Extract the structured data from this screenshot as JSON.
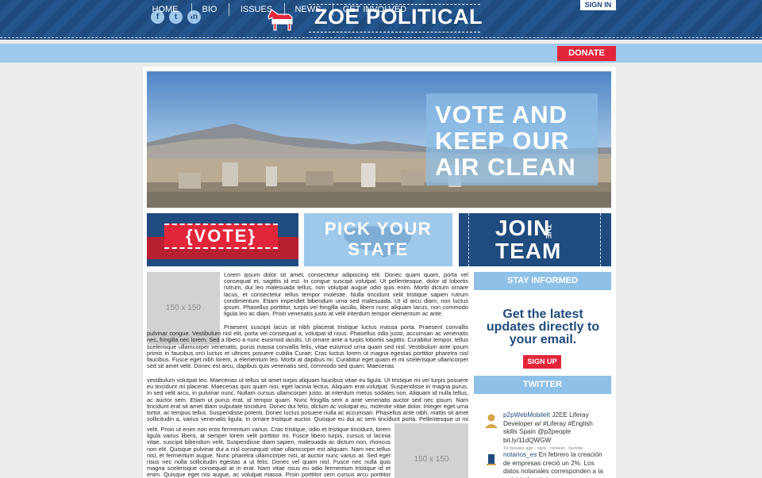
{
  "header": {
    "social": [
      {
        "name": "facebook",
        "glyph": "f"
      },
      {
        "name": "twitter",
        "glyph": "t"
      },
      {
        "name": "linkedin",
        "glyph": "in"
      }
    ],
    "logo_text": "ZOE POLITICAL",
    "signin_label": "SIGN IN"
  },
  "nav": {
    "items": [
      "HOME",
      "BIO",
      "ISSUES",
      "NEWS",
      "GET INVOLVED"
    ],
    "donate_label": "DONATE"
  },
  "hero": {
    "headline_lines": [
      "VOTE AND",
      "KEEP OUR",
      "AIR CLEAN"
    ]
  },
  "tiles": {
    "vote": "{VOTE}",
    "pick_state_lines": [
      "PICK YOUR",
      "STATE"
    ],
    "join": "JOIN",
    "the": "THE",
    "team": "TEAM"
  },
  "placeholders": {
    "label": "150 x 150"
  },
  "article": {
    "p1": "Lorem ipsum dolor sit amet, consectetur adipiscing elit. Donec quam quam, porta vel consequat et, sagittis id est. In congue suscipit volutpat. Ut pellentesque, dolor id lobortis rutrum, dui leo malesuada tellus, non volutpat augue odio quis enim. Morbi dictum ornare lacus, et consectetur tellus tempor molestie. Nulla tincidunt velit tristique sapien rutrum condimentum. Etiam imperdiet bibendum urna sed malesuada. Ut id arcu diam, non luctus ipsum. Phasellus porttitor, turpis vel fringilla iaculis, libero nunc aliquam lacus, non commodo ligula leo ac diam. Proin venenatis justo at velit interdum tempor elementum ac ante.",
    "p2": "Praesent suscipit lacus at nibh placerat tristique luctus massa porta. Praesent convallis pulvinar congue. Vestibulum nisl elit, porta vel consequat a, volutpat id risus. Phasellus odio justo, accumsan ac venenatis nec, fringilla nec lorem. Sed a libero a nunc euismod iaculis. Ut ornare ante a turpis lobortis sagittis. Curabitur tempor, tellus scelerisque ullamcorper venenatis, purus massa convallis felis, vitae euismod urna quam sed nisl. Vestibulum ante ipsum primis in faucibus orci luctus et ultrices posuere cubilia Curae; Cras luctus lorem ut magna egestas porttitor pharetra nisl faucibus. Fusce eget nibh lorem, a elementum leo. Morbi at dapibus mi. Curabitur eget quam et mi scelerisque ullamcorper sed sit amet velit. Donec est arcu, dapibus quis venenatis sed, commodo sed quam. Maecenas",
    "p3": "vestibulum volutpat leo. Maecenas ut tellus sit amet turpis aliquam faucibus vitae eu ligula. Ut tristique mi vel turpis posuere eu tincidunt mi placerat. Maecenas quis quam nisi, eget lacinia lectus. Aliquam erat volutpat. Suspendisse in magna purus. In sed velit arcu, in pulvinar nunc. Nullam cursus ullamcorper justo, at interdum metus sodales non. Aliquam id nulla tellus, ac auctor sem. Etiam ut purus erat, id tempor quam. Nunc fringilla sem a ante venenatis auctor sed nec ipsum. Nam tincidunt erat sit amet diam vulputate tincidunt. Donec dui felis, dictum ac volutpat eu, molestie vitae dolor. Integer eget urna tortor, ac tempus tellus. Suspendisse potenti. Donec luctus posuere nulla ac accumsan. Phasellus ante nibh, mattis sit amet sollicitudin a, varius venenatis ligula. In ornare tristique auctor. Quisque eu dui ac sem tincidunt porta. Pellentesque ut mi dui, sit amet sagittis lorem. Pellentesque et aliquam",
    "p4": "velit. Proin ut enim non eros fermentum varius. Cras tristique, odio et tristique tincidunt, lorem ligula varius libero, at semper lorem velit porttitor mi. Fusce libero turpis, cursus ut lacinia vitae, suscipit bibendum velit. Suspendisse diam sapien, malesuada ac dictum non, rhoncus non elit. Quisque pulvinar dui a nisl consequat vitae ullamcorper est aliquam. Nam nec tellus nisl, et fermentum augue. Nunc pharetra ullamcorper nisi, at auctor nunc varius at. Sed eget risus nec nulla sollicitudin egestas a ut felis. Donec vel quam nisl. Fusce nec nulla quis magna scelerisque consequat at in erat. Nam vitae risus eu odio fermentum tristique id et enim. Quisque eget nisi augue, ac volutpat massa. Proin porttitor sem cursus arcu porttitor congue. Nam ut nisi at tellus feugiat varius at in ipsum. Morbi posuere sollicitudin mi."
  },
  "sidebar": {
    "stay_informed": "STAY INFORMED",
    "cta_lines": [
      "Get the latest",
      "updates directly to",
      "your email."
    ],
    "signup_label": "SIGN UP",
    "twitter": "TWITTER",
    "tweets": [
      {
        "user": "p2pWebMobileIt",
        "text": " J2EE Liferay Developer w/ #Liferay #English skills Spain @p2people bit.ly/11dQWGW",
        "meta": "19 minutes ago · reply · retweet · favorite"
      },
      {
        "user": "notarios_es",
        "text": " En febrero la creación de empresas creció un 2%. Los datos notariales corresponden a la actividad real de ese mes"
      }
    ]
  },
  "colors": {
    "navy": "#1f4b7e",
    "sky": "#9fc9ea",
    "red": "#e3253a"
  }
}
